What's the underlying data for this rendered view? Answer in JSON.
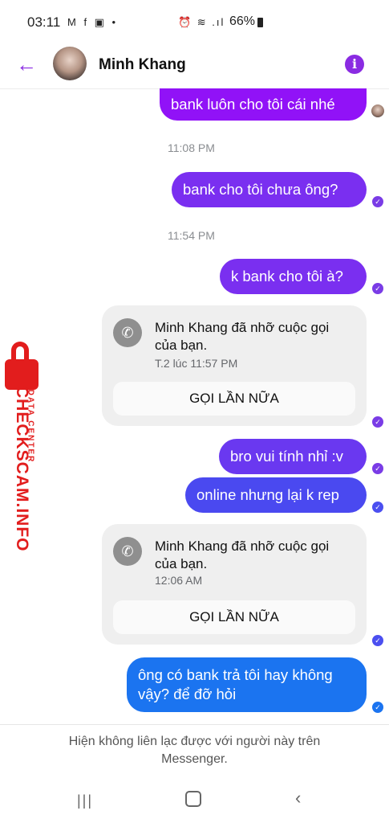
{
  "status_bar": {
    "time": "03:11",
    "left_icons": "M f ▣ •",
    "right_icons": "⏰ ≋ .ıl",
    "battery": "66%"
  },
  "header": {
    "contact_name": "Minh Khang",
    "back_icon": "arrow-left-icon",
    "info_icon": "info-icon"
  },
  "messages": {
    "m1": "bank luôn cho tôi cái nhé",
    "ts1": "11:08 PM",
    "m2": "bank cho tôi chưa ông?",
    "ts2": "11:54 PM",
    "m3": "k bank cho tôi à?",
    "call1": {
      "line1": "Minh Khang đã nhỡ cuộc gọi",
      "line2": "của bạn.",
      "time": "T.2 lúc 11:57 PM",
      "button": "GỌI LẦN NỮA"
    },
    "m4": "bro vui tính nhỉ :v",
    "m5": "online nhưng lại k rep",
    "call2": {
      "line1": "Minh Khang đã nhỡ cuộc gọi",
      "line2": "của bạn.",
      "time": "12:06 AM",
      "button": "GỌI LẦN NỮA"
    },
    "m6_line1": "ông có bank trả tôi hay không",
    "m6_line2": "vậy? để đỡ hỏi"
  },
  "watermark": {
    "main": "CHECKSCAM.INFO",
    "sub": "DATA CENTER"
  },
  "footer": {
    "line1": "Hiện không liên lạc được với người này trên",
    "line2": "Messenger."
  },
  "colors": {
    "accent": "#8a2be2",
    "bubble_purple": "#9112f7",
    "bubble_blue": "#1b74f0",
    "watermark": "#e21d1d"
  }
}
